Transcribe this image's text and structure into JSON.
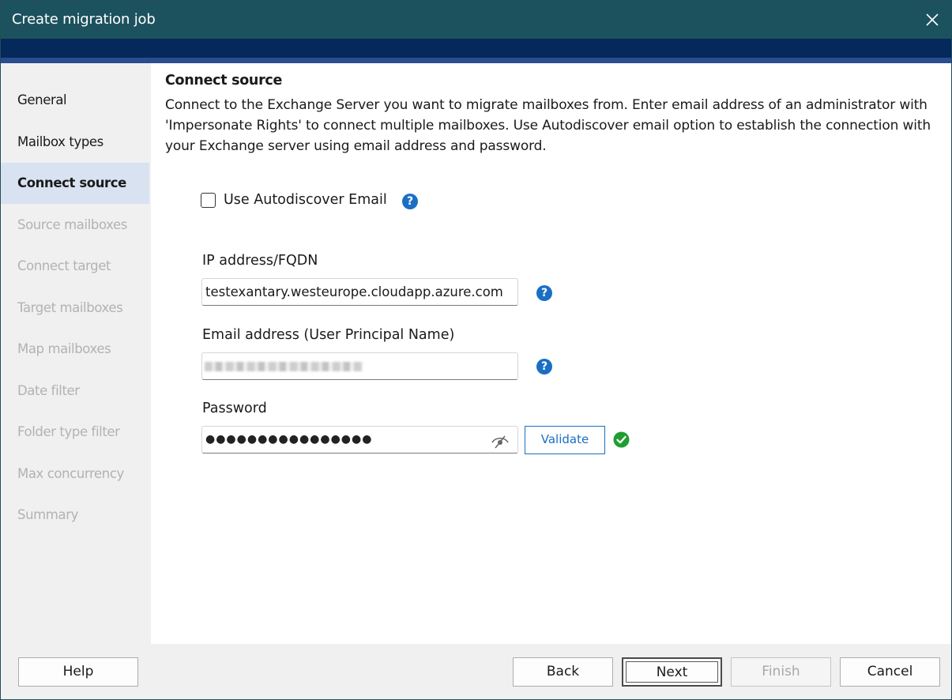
{
  "window": {
    "title": "Create migration job"
  },
  "sidebar": {
    "items": [
      {
        "label": "General",
        "state": "done"
      },
      {
        "label": "Mailbox types",
        "state": "done"
      },
      {
        "label": "Connect source",
        "state": "active"
      },
      {
        "label": "Source mailboxes",
        "state": "disabled"
      },
      {
        "label": "Connect target",
        "state": "disabled"
      },
      {
        "label": "Target mailboxes",
        "state": "disabled"
      },
      {
        "label": "Map mailboxes",
        "state": "disabled"
      },
      {
        "label": "Date filter",
        "state": "disabled"
      },
      {
        "label": "Folder type filter",
        "state": "disabled"
      },
      {
        "label": "Max concurrency",
        "state": "disabled"
      },
      {
        "label": "Summary",
        "state": "disabled"
      }
    ]
  },
  "main": {
    "heading": "Connect source",
    "description": "Connect to the Exchange Server you want to migrate mailboxes from. Enter email address of an administrator with 'Impersonate Rights' to connect multiple mailboxes. Use Autodiscover email option to establish the connection with your Exchange server using email address and password.",
    "autodiscover": {
      "label": "Use Autodiscover Email",
      "checked": false
    },
    "ip": {
      "label": "IP address/FQDN",
      "value": "testexantary.westeurope.cloudapp.azure.com"
    },
    "email": {
      "label": "Email address (User Principal Name)"
    },
    "password": {
      "label": "Password",
      "value": "●●●●●●●●●●●●●●●●"
    },
    "validate_label": "Validate",
    "help_glyph": "?"
  },
  "footer": {
    "help": "Help",
    "back": "Back",
    "next": "Next",
    "finish": "Finish",
    "cancel": "Cancel"
  },
  "colors": {
    "titlebar": "#1c525e",
    "banner": "#04295a",
    "accent": "#1a6fc4",
    "active_nav": "#d9e2f0",
    "success": "#1e9e2f"
  }
}
